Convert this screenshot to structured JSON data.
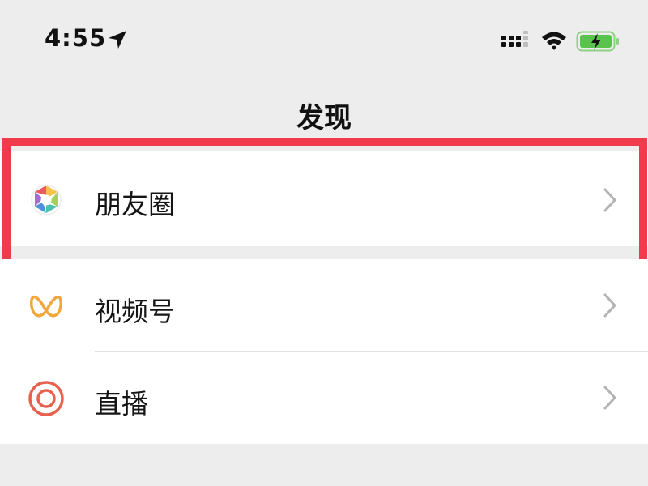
{
  "status_bar": {
    "time": "4:55",
    "location_icon": "location-arrow-icon",
    "signal_icon": "cellular-signal-icon",
    "wifi_icon": "wifi-icon",
    "battery_icon": "battery-charging-icon",
    "battery_color": "#5ac34e"
  },
  "nav": {
    "title": "发现"
  },
  "highlight_color": "#f03c4a",
  "items": [
    {
      "label": "朋友圈",
      "icon": "moments-shutter-icon"
    },
    {
      "label": "视频号",
      "icon": "channels-icon",
      "icon_color": "#f3a73a"
    },
    {
      "label": "直播",
      "icon": "live-icon",
      "icon_color": "#e8604e"
    }
  ]
}
